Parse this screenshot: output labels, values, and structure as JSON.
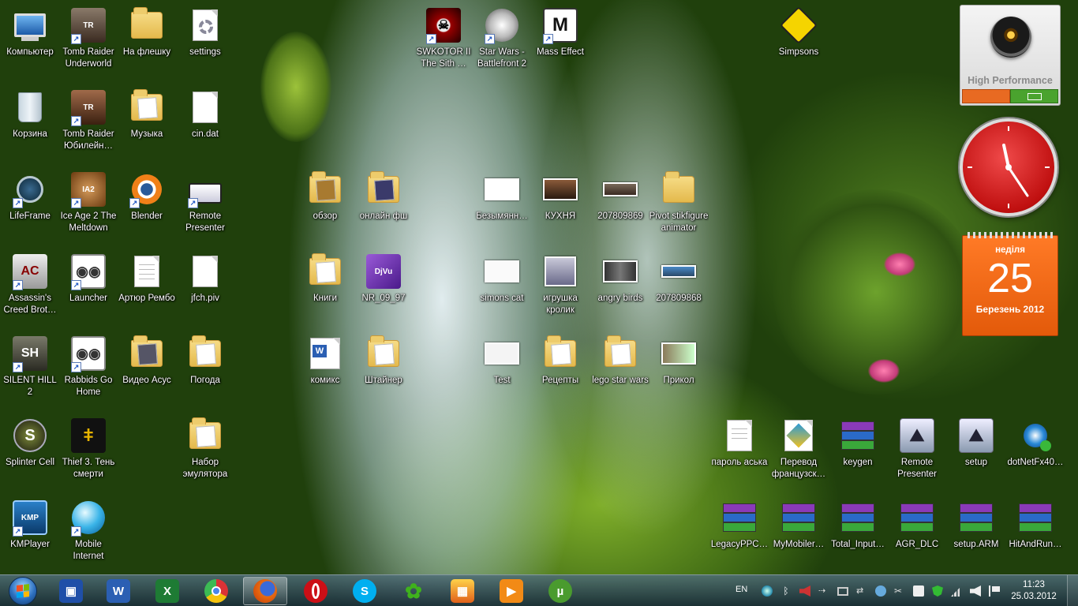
{
  "desktop": {
    "col1": [
      {
        "label": "Компьютер",
        "icon": "computer-icon"
      },
      {
        "label": "Корзина",
        "icon": "recycle-bin-icon"
      },
      {
        "label": "LifeFrame",
        "icon": "webcam-icon"
      },
      {
        "label": "Assassin's Creed Brot…",
        "icon": "game-icon"
      },
      {
        "label": "SILENT HILL 2",
        "icon": "game-icon"
      },
      {
        "label": "Splinter Cell",
        "icon": "game-icon"
      },
      {
        "label": "KMPlayer",
        "icon": "kmplayer-icon"
      }
    ],
    "col2": [
      {
        "label": "Tomb Raider Underworld",
        "icon": "game-icon"
      },
      {
        "label": "Tomb Raider Юбилейн…",
        "icon": "game-icon"
      },
      {
        "label": "Ice Age 2 The Meltdown",
        "icon": "game-icon"
      },
      {
        "label": "Launcher",
        "icon": "rabbid-icon"
      },
      {
        "label": "Rabbids Go Home",
        "icon": "rabbid-icon"
      },
      {
        "label": "Thief 3. Тень смерти",
        "icon": "game-icon"
      },
      {
        "label": "Mobile Internet",
        "icon": "globe-icon"
      }
    ],
    "col3": [
      {
        "label": "На флешку",
        "icon": "folder-icon"
      },
      {
        "label": "Музыка",
        "icon": "folder-icon"
      },
      {
        "label": "Blender",
        "icon": "blender-icon"
      },
      {
        "label": "Артюр Рембо",
        "icon": "document-icon"
      },
      {
        "label": "Видео Асус",
        "icon": "folder-icon"
      }
    ],
    "col4": [
      {
        "label": "settings",
        "icon": "settings-file-icon"
      },
      {
        "label": "cin.dat",
        "icon": "document-icon"
      },
      {
        "label": "Remote Presenter",
        "icon": "scanner-icon"
      },
      {
        "label": "jfch.piv",
        "icon": "document-icon"
      },
      {
        "label": "Погода",
        "icon": "folder-icon"
      },
      {
        "label": "Набор эмулятора",
        "icon": "folder-icon"
      }
    ],
    "mid": [
      {
        "label": "обзор",
        "icon": "folder-icon"
      },
      {
        "label": "онлайн фш",
        "icon": "folder-icon"
      },
      {
        "label": "Книги",
        "icon": "folder-icon"
      },
      {
        "label": "NR_09_97",
        "icon": "djvu-icon"
      },
      {
        "label": "комикс",
        "icon": "word-doc-icon"
      },
      {
        "label": "Штайнер",
        "icon": "folder-icon"
      }
    ],
    "top_games": [
      {
        "label": "SWKOTOR II The Sith …",
        "icon": "game-icon"
      },
      {
        "label": "Star Wars - Battlefront 2",
        "icon": "game-icon"
      },
      {
        "label": "Mass Effect",
        "icon": "game-icon"
      },
      {
        "label": "Simpsons",
        "icon": "game-icon"
      }
    ],
    "media": [
      {
        "label": "Безымянн…",
        "icon": "image-icon"
      },
      {
        "label": "КУХНЯ",
        "icon": "image-icon"
      },
      {
        "label": "207809869",
        "icon": "image-icon"
      },
      {
        "label": "Pivot stikfigure animator",
        "icon": "folder-icon"
      },
      {
        "label": "simons cat",
        "icon": "image-icon"
      },
      {
        "label": "игрушка кролик",
        "icon": "image-icon"
      },
      {
        "label": "angry birds",
        "icon": "image-icon"
      },
      {
        "label": "207809868",
        "icon": "image-icon"
      },
      {
        "label": "Test",
        "icon": "image-icon"
      },
      {
        "label": "Рецепты",
        "icon": "folder-icon"
      },
      {
        "label": "lego star wars",
        "icon": "folder-icon"
      },
      {
        "label": "Прикол",
        "icon": "image-icon"
      }
    ],
    "bottom_row1": [
      {
        "label": "пароль аська",
        "icon": "document-icon"
      },
      {
        "label": "Перевод французск…",
        "icon": "translator-icon"
      },
      {
        "label": "keygen",
        "icon": "winrar-icon"
      },
      {
        "label": "Remote Presenter",
        "icon": "installer-icon"
      },
      {
        "label": "setup",
        "icon": "installer-icon"
      },
      {
        "label": "dotNetFx40…",
        "icon": "setup-icon"
      }
    ],
    "bottom_row2": [
      {
        "label": "LegacyPPC…",
        "icon": "winrar-icon"
      },
      {
        "label": "MyMobiler…",
        "icon": "winrar-icon"
      },
      {
        "label": "Total_Input…",
        "icon": "winrar-icon"
      },
      {
        "label": "AGR_DLC",
        "icon": "winrar-icon"
      },
      {
        "label": "setup.ARM",
        "icon": "winrar-icon"
      },
      {
        "label": "HitAndRun…",
        "icon": "winrar-icon"
      }
    ]
  },
  "gadgets": {
    "performance": {
      "title": "High Performance"
    },
    "calendar": {
      "weekday": "неділя",
      "day": "25",
      "month_year": "Березень 2012"
    }
  },
  "taskbar": {
    "pinned": [
      {
        "name": "save-app",
        "color": "#1f4fa8"
      },
      {
        "name": "word",
        "color": "#2b5fb3"
      },
      {
        "name": "excel",
        "color": "#1e7b34"
      },
      {
        "name": "chrome",
        "color": "#e0b400"
      },
      {
        "name": "firefox",
        "color": "#e86a10"
      },
      {
        "name": "opera",
        "color": "#cc0f16"
      },
      {
        "name": "skype",
        "color": "#00aff0"
      },
      {
        "name": "icq",
        "color": "#3fb21c"
      },
      {
        "name": "paint",
        "color": "#f0a020"
      },
      {
        "name": "media-player",
        "color": "#f28a16"
      },
      {
        "name": "utorrent",
        "color": "#4a9b2e"
      }
    ],
    "language": "EN",
    "time": "11:23",
    "date": "25.03.2012"
  }
}
